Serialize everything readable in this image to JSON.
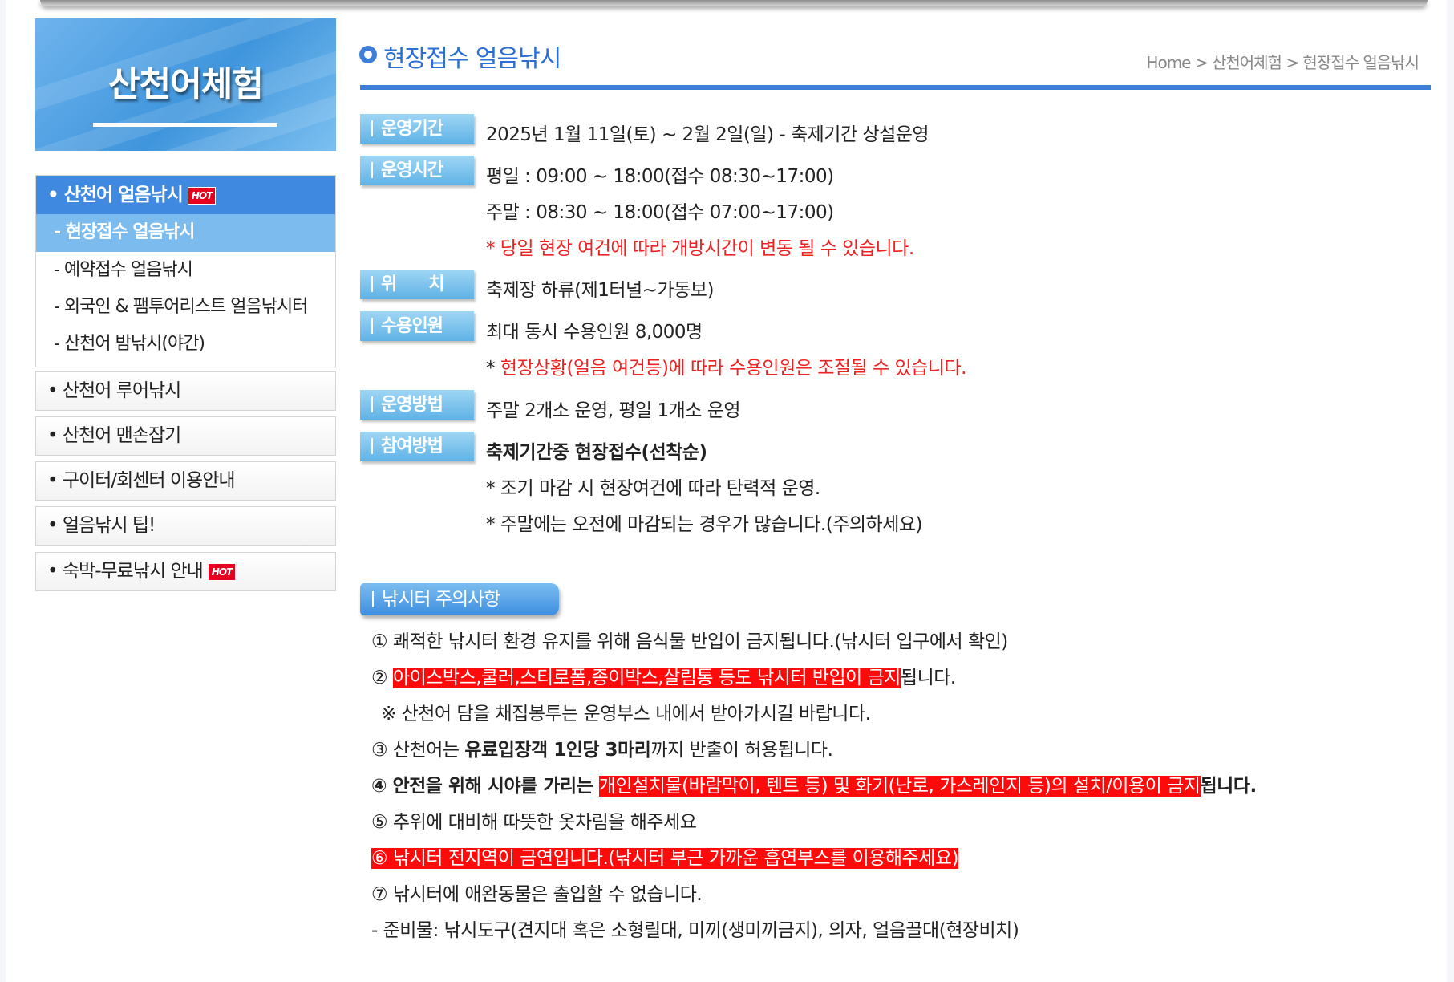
{
  "sidebar": {
    "banner_title": "산천어체험",
    "hot_badge": "HOT",
    "main_item": "• 산천어 얼음낚시",
    "sub_items": [
      "- 현장접수 얼음낚시",
      "- 예약접수 얼음낚시",
      "- 외국인 & 팸투어리스트 얼음낚시터",
      "- 산천어 밤낚시(야간)"
    ],
    "items": [
      "• 산천어 루어낚시",
      "• 산천어 맨손잡기",
      "• 구이터/회센터 이용안내",
      "• 얼음낚시 팁!",
      "• 숙박-무료낚시 안내"
    ]
  },
  "header": {
    "title": "현장접수 얼음낚시",
    "breadcrumb": "Home > 산천어체험 > 현장접수 얼음낚시"
  },
  "info": {
    "period_label": "운영기간",
    "period_value": "2025년 1월 11일(토) ~ 2월 2일(일) - 축제기간 상설운영",
    "hours_label": "운영시간",
    "hours_weekday": "평일 : 09:00 ~ 18:00(접수 08:30~17:00)",
    "hours_weekend": "주말 : 08:30 ~ 18:00(접수 07:00~17:00)",
    "hours_note": "* 당일 현장 여건에 따라 개방시간이 변동 될 수 있습니다.",
    "location_label": "위      치",
    "location_value": "축제장 하류(제1터널~가동보)",
    "capacity_label": "수용인원",
    "capacity_value": "최대 동시 수용인원 8,000명",
    "capacity_note_star": "* ",
    "capacity_note": "현장상황(얼음 여건등)에 따라 수용인원은 조절될 수 있습니다.",
    "method_label": "운영방법",
    "method_value": "주말 2개소 운영, 평일 1개소 운영",
    "join_label": "참여방법",
    "join_value": "축제기간중 현장접수(선착순)",
    "join_note1": "* 조기 마감 시 현장여건에 따라 탄력적 운영.",
    "join_note2": "* 주말에는 오전에 마감되는 경우가 많습니다.(주의하세요)"
  },
  "notice": {
    "title": "낚시터 주의사항",
    "n1": "① 쾌적한 낚시터 환경 유지를 위해 음식물 반입이 금지됩니다.(낚시터 입구에서 확인)",
    "n2_prefix": "② ",
    "n2_highlight": "아이스박스,쿨러,스티로폼,종이박스,살림통 등도 낚시터 반입이 금지",
    "n2_suffix": "됩니다.",
    "n2_sub": "※ 산천어 담을 채집봉투는 운영부스 내에서 받아가시길 바랍니다.",
    "n3_prefix": "③ 산천어는 ",
    "n3_bold": "유료입장객 1인당 3마리",
    "n3_suffix": "까지 반출이 허용됩니다.",
    "n4_prefix": "④ 안전을 위해 시야를 가리는 ",
    "n4_highlight": "개인설치물(바람막이, 텐트 등) 및 화기(난로, 가스레인지 등)의 설치/이용이 금지",
    "n4_suffix": "됩니다.",
    "n5": "⑤ 추위에 대비해 따뜻한 옷차림을 해주세요",
    "n6": "⑥ 낚시터 전지역이 금연입니다.(낚시터 부근 가까운 흡연부스를 이용해주세요)",
    "n7": "⑦ 낚시터에 애완동물은 출입할 수 없습니다.",
    "n8": "- 준비물: 낚시도구(견지대 혹은 소형릴대, 미끼(생미끼금지), 의자, 얼음끌대(현장비치)"
  }
}
